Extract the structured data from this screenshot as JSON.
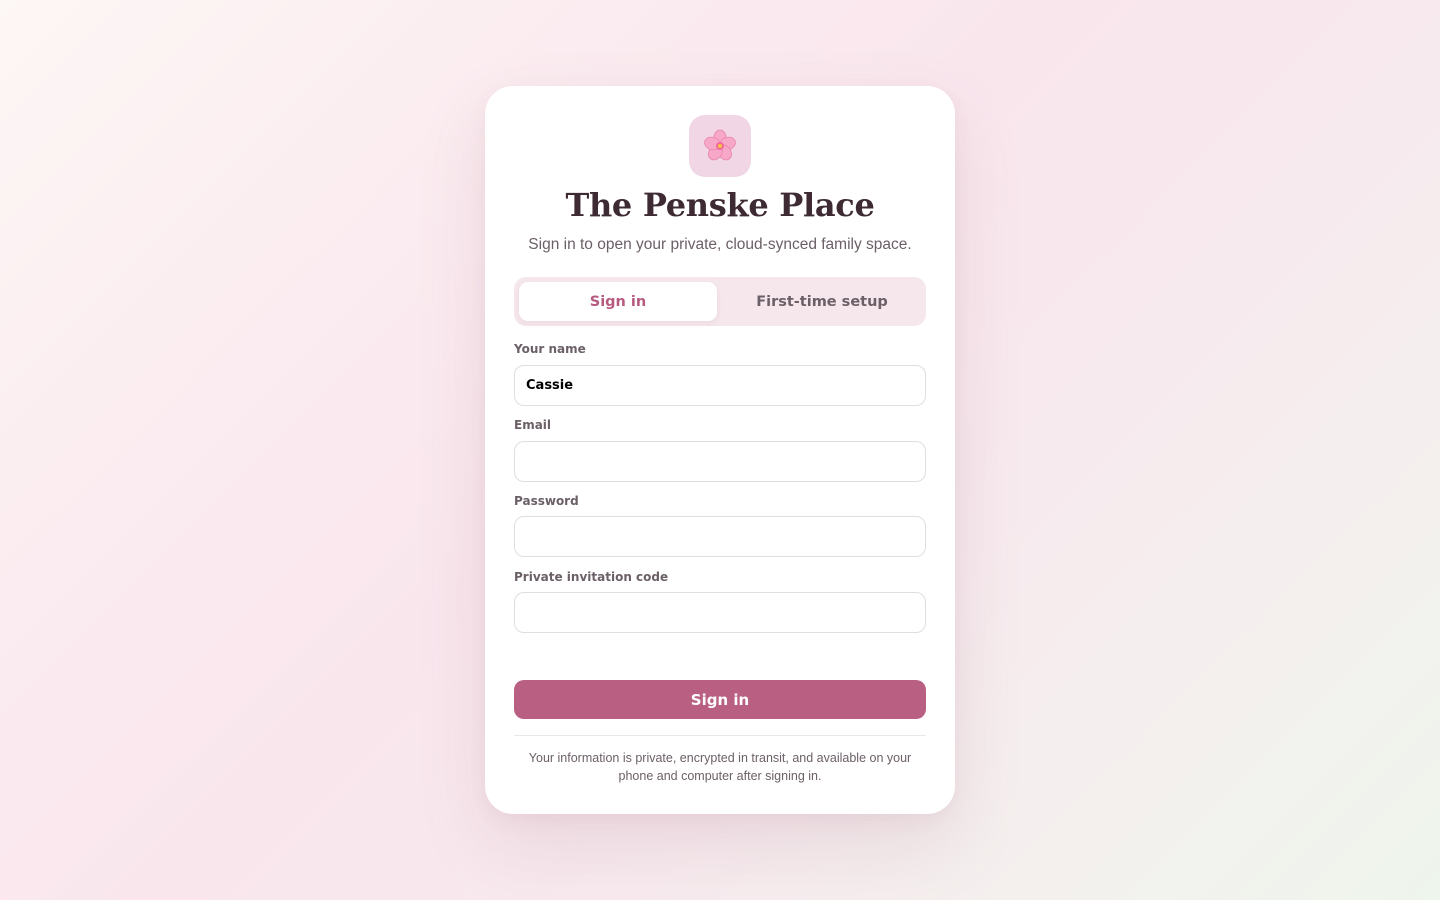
{
  "app": {
    "title": "The Penske Place",
    "subtitle": "Sign in to open your private, cloud-synced family space.",
    "logo_icon": "cherry-blossom-icon"
  },
  "tabs": [
    {
      "label": "Sign in",
      "active": true
    },
    {
      "label": "First-time setup",
      "active": false
    }
  ],
  "form": {
    "name": {
      "label": "Your name",
      "value": "Cassie"
    },
    "email": {
      "label": "Email",
      "value": ""
    },
    "password": {
      "label": "Password",
      "value": ""
    },
    "invite": {
      "label": "Private invitation code",
      "value": ""
    },
    "submit_label": "Sign in"
  },
  "footer": "Your information is private, encrypted in transit, and available on your phone and computer after signing in.",
  "colors": {
    "accent": "#b95f82",
    "logo_bg": "#f1d6e6",
    "tab_bg": "#f5e7ec"
  }
}
